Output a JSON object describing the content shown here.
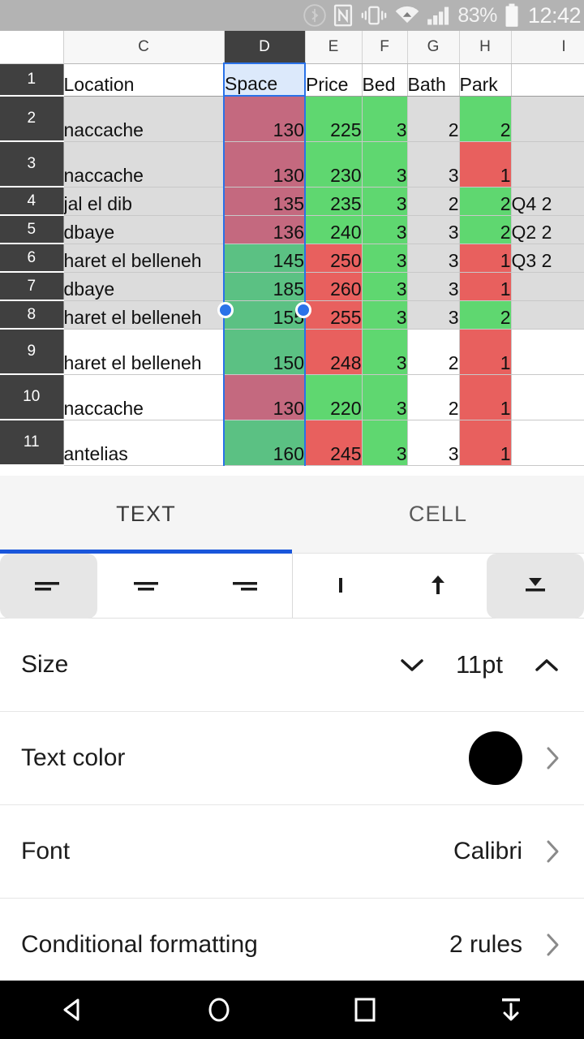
{
  "status_bar": {
    "battery_percent": "83%",
    "clock": "12:42",
    "icons": [
      "bluetooth-icon",
      "nfc-icon",
      "vibrate-icon",
      "wifi-icon",
      "signal-icon",
      "battery-icon"
    ]
  },
  "spreadsheet": {
    "column_headers": [
      "C",
      "D",
      "E",
      "F",
      "G",
      "H",
      "I"
    ],
    "selected_column": "D",
    "active_cell": "D1",
    "row_headers": [
      "1",
      "2",
      "3",
      "4",
      "5",
      "6",
      "7",
      "8",
      "9",
      "10",
      "11"
    ],
    "header_row": {
      "C": "Location",
      "D": "Space",
      "E": "Price",
      "F": "Bed",
      "G": "Bath",
      "H": "Park",
      "I": ""
    },
    "rows": [
      {
        "row": "2",
        "C": "naccache",
        "D": "130",
        "E": "225",
        "F": "3",
        "G": "2",
        "H": "2",
        "I": "",
        "fill": {
          "C": "grey",
          "D": "selred",
          "E": "green",
          "F": "green",
          "G": "grey",
          "H": "green",
          "I": "grey"
        }
      },
      {
        "row": "3",
        "C": "naccache",
        "D": "130",
        "E": "230",
        "F": "3",
        "G": "3",
        "H": "1",
        "I": "",
        "fill": {
          "C": "grey",
          "D": "selred",
          "E": "green",
          "F": "green",
          "G": "grey",
          "H": "red",
          "I": "grey"
        }
      },
      {
        "row": "4",
        "C": "jal el dib",
        "D": "135",
        "E": "235",
        "F": "3",
        "G": "2",
        "H": "2",
        "I": "Q4 2",
        "fill": {
          "C": "grey",
          "D": "selred",
          "E": "green",
          "F": "green",
          "G": "grey",
          "H": "green",
          "I": "grey"
        }
      },
      {
        "row": "5",
        "C": "dbaye",
        "D": "136",
        "E": "240",
        "F": "3",
        "G": "3",
        "H": "2",
        "I": "Q2 2",
        "fill": {
          "C": "grey",
          "D": "selred",
          "E": "green",
          "F": "green",
          "G": "grey",
          "H": "green",
          "I": "grey"
        }
      },
      {
        "row": "6",
        "C": "haret el belleneh",
        "D": "145",
        "E": "250",
        "F": "3",
        "G": "3",
        "H": "1",
        "I": "Q3 2",
        "fill": {
          "C": "grey",
          "D": "selgreen",
          "E": "red",
          "F": "green",
          "G": "grey",
          "H": "red",
          "I": "grey"
        }
      },
      {
        "row": "7",
        "C": "dbaye",
        "D": "185",
        "E": "260",
        "F": "3",
        "G": "3",
        "H": "1",
        "I": "",
        "fill": {
          "C": "grey",
          "D": "selgreen",
          "E": "red",
          "F": "green",
          "G": "grey",
          "H": "red",
          "I": "grey"
        }
      },
      {
        "row": "8",
        "C": "haret el belleneh",
        "D": "155",
        "E": "255",
        "F": "3",
        "G": "3",
        "H": "2",
        "I": "",
        "fill": {
          "C": "grey",
          "D": "selgreen",
          "E": "red",
          "F": "green",
          "G": "grey",
          "H": "green",
          "I": "grey"
        }
      },
      {
        "row": "9",
        "C": "haret el belleneh",
        "D": "150",
        "E": "248",
        "F": "3",
        "G": "2",
        "H": "1",
        "I": "",
        "fill": {
          "C": "white",
          "D": "selgreen",
          "E": "red",
          "F": "green",
          "G": "white",
          "H": "red",
          "I": "white"
        }
      },
      {
        "row": "10",
        "C": "naccache",
        "D": "130",
        "E": "220",
        "F": "3",
        "G": "2",
        "H": "1",
        "I": "",
        "fill": {
          "C": "white",
          "D": "selred",
          "E": "green",
          "F": "green",
          "G": "white",
          "H": "red",
          "I": "white"
        }
      },
      {
        "row": "11",
        "C": "antelias",
        "D": "160",
        "E": "245",
        "F": "3",
        "G": "3",
        "H": "1",
        "I": "",
        "fill": {
          "C": "white",
          "D": "selgreen",
          "E": "red",
          "F": "green",
          "G": "white",
          "H": "red",
          "I": "white"
        }
      }
    ]
  },
  "panel": {
    "tabs": [
      {
        "label": "TEXT",
        "active": true
      },
      {
        "label": "CELL",
        "active": false
      }
    ],
    "alignment": {
      "horizontal": [
        "align-left-icon",
        "align-center-icon",
        "align-right-icon"
      ],
      "horizontal_selected": 0,
      "vertical": [
        "align-top-icon",
        "align-middle-icon",
        "align-bottom-icon"
      ],
      "vertical_selected": 2
    },
    "options": [
      {
        "label": "Size",
        "value": "11pt",
        "control": "stepper",
        "decrement_icon": "chevron-down-icon",
        "increment_icon": "chevron-up-icon"
      },
      {
        "label": "Text color",
        "value": "",
        "control": "color",
        "color": "#000000",
        "chevron_icon": "chevron-right-icon"
      },
      {
        "label": "Font",
        "value": "Calibri",
        "control": "link",
        "chevron_icon": "chevron-right-icon"
      },
      {
        "label": "Conditional formatting",
        "value": "2 rules",
        "control": "link",
        "chevron_icon": "chevron-right-icon"
      }
    ]
  },
  "navbar": {
    "buttons": [
      "back-icon",
      "home-icon",
      "recents-icon",
      "hide-keyboard-icon"
    ]
  },
  "colors": {
    "accent": "#1a56db",
    "selection": "#2a72e8",
    "cf_green": "#5fd770",
    "cf_red": "#e8605e",
    "selected_red": "#c4697f",
    "selected_green": "#5bc183",
    "header_dark": "#404040",
    "statusbar": "#b3b3b3"
  }
}
